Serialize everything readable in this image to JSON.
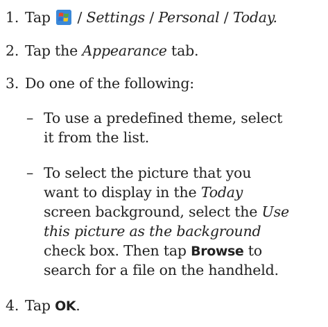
{
  "steps": [
    {
      "number": "1.",
      "tap": "Tap",
      "path_sep_1": "/",
      "path_settings": "Settings",
      "path_sep_2": "/",
      "path_personal": "Personal",
      "path_sep_3": "/",
      "path_today": "Today."
    },
    {
      "number": "2.",
      "text_before": "Tap the",
      "tab_name": "Appearance",
      "text_after": "tab."
    },
    {
      "number": "3.",
      "text": "Do one of the following:",
      "bullets": [
        {
          "dash": "–",
          "line1": "To use a predefined theme, select",
          "line2": "it from the list."
        },
        {
          "dash": "–",
          "line1": "To select the picture that you",
          "line2": "want to display in the",
          "line2_em": "Today",
          "line3": "screen background, select the",
          "line3_em": "Use",
          "line4_em": "this picture as the background",
          "line5": "check box. Then tap",
          "line5_btn": "Browse",
          "line5_after": "to",
          "line6": "search for a file on the handheld."
        }
      ]
    },
    {
      "number": "4.",
      "text": "Tap",
      "button": "OK",
      "after": "."
    }
  ],
  "icons": {
    "start": "windows-start-icon",
    "start_colors": [
      "#e8472b",
      "#5aa93a",
      "#2f7dd6",
      "#f3c51e"
    ]
  }
}
